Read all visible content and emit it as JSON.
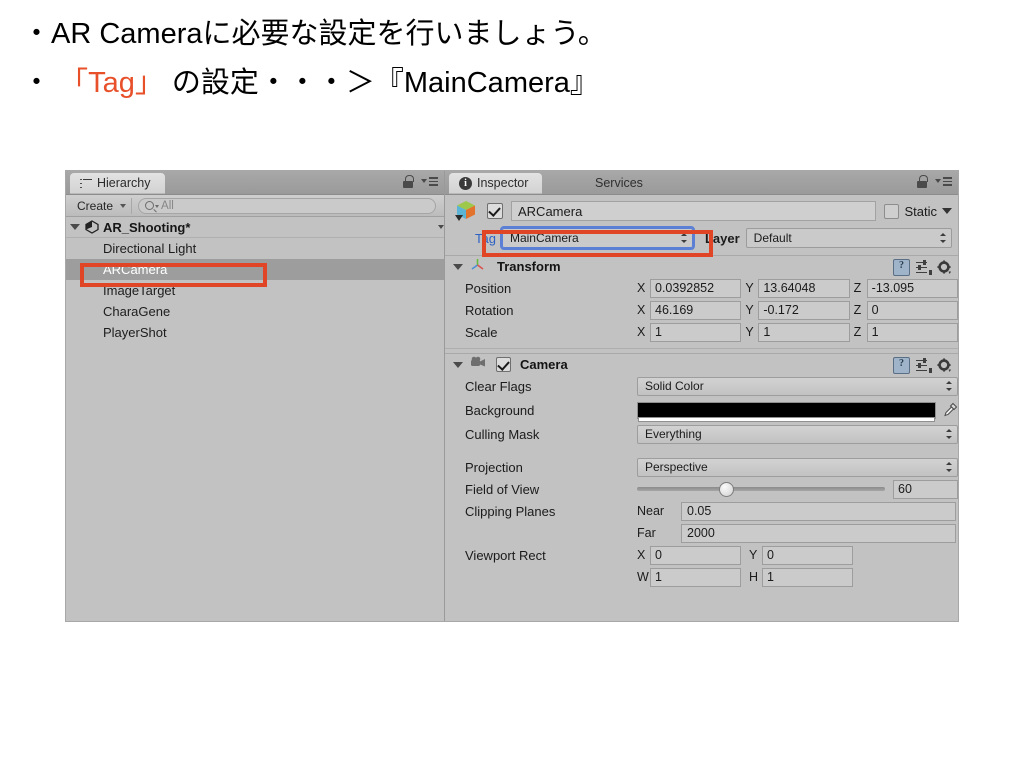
{
  "slide": {
    "line1": "・AR Cameraに必要な設定を行いましょう。",
    "line2_prefix": "・ ",
    "line2_highlight": "「Tag」",
    "line2_rest": " の設定・・・＞『MainCamera』",
    "highlight_color": "#e8502a"
  },
  "hierarchy": {
    "tab_label": "Hierarchy",
    "create_label": "Create",
    "search_placeholder": "All",
    "scene_name": "AR_Shooting*",
    "items": [
      {
        "label": "Directional Light",
        "selected": false
      },
      {
        "label": "ARCamera",
        "selected": true
      },
      {
        "label": "ImageTarget",
        "selected": false
      },
      {
        "label": "CharaGene",
        "selected": false
      },
      {
        "label": "PlayerShot",
        "selected": false
      }
    ]
  },
  "inspector": {
    "tab_label": "Inspector",
    "tab2_label": "Services",
    "object_name": "ARCamera",
    "object_enabled": true,
    "static_label": "Static",
    "static_checked": false,
    "tag_label": "Tag",
    "tag_value": "MainCamera",
    "layer_label": "Layer",
    "layer_value": "Default",
    "transform": {
      "title": "Transform",
      "rows": [
        {
          "label": "Position",
          "x": "0.0392852",
          "y": "13.64048",
          "z": "-13.095"
        },
        {
          "label": "Rotation",
          "x": "46.169",
          "y": "-0.172",
          "z": "0"
        },
        {
          "label": "Scale",
          "x": "1",
          "y": "1",
          "z": "1"
        }
      ],
      "axis_labels": [
        "X",
        "Y",
        "Z"
      ]
    },
    "camera": {
      "title": "Camera",
      "enabled": true,
      "clear_flags_label": "Clear Flags",
      "clear_flags_value": "Solid Color",
      "background_label": "Background",
      "background_color": "#000000",
      "culling_mask_label": "Culling Mask",
      "culling_mask_value": "Everything",
      "projection_label": "Projection",
      "projection_value": "Perspective",
      "fov_label": "Field of View",
      "fov_value": "60",
      "fov_percent": 33,
      "clipping_label": "Clipping Planes",
      "near_label": "Near",
      "near_value": "0.05",
      "far_label": "Far",
      "far_value": "2000",
      "viewport_label": "Viewport Rect",
      "viewport_x_label": "X",
      "viewport_x": "0",
      "viewport_y_label": "Y",
      "viewport_y": "0",
      "viewport_w_label": "W",
      "viewport_w": "1",
      "viewport_h_label": "H",
      "viewport_h": "1"
    }
  },
  "annotations": {
    "box_color": "#e04526",
    "box1_target": "ARCamera hierarchy item",
    "box2_target": "Tag dropdown field"
  }
}
